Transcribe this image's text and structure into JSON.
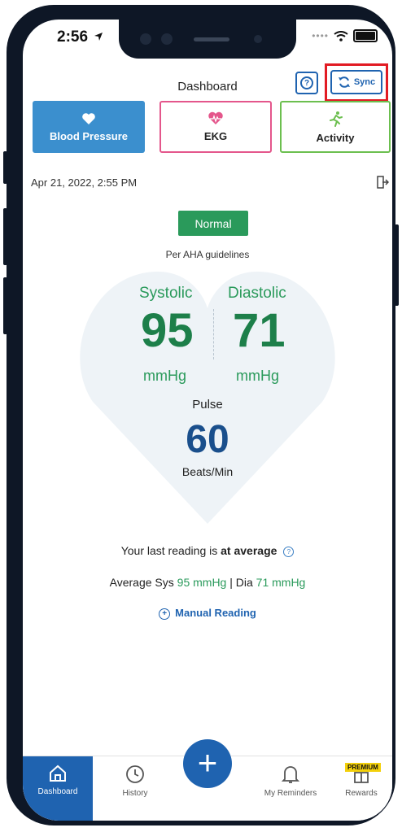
{
  "status_bar": {
    "time": "2:56"
  },
  "header": {
    "title": "Dashboard",
    "sync_label": "Sync"
  },
  "tabs": [
    {
      "label": "Blood Pressure",
      "icon": "heart-icon"
    },
    {
      "label": "EKG",
      "icon": "ekg-heart-icon"
    },
    {
      "label": "Activity",
      "icon": "runner-icon"
    }
  ],
  "reading": {
    "datetime": "Apr 21, 2022, 2:55 PM",
    "category": "Normal",
    "guideline": "Per AHA guidelines",
    "systolic_label": "Systolic",
    "systolic_value": "95",
    "diastolic_label": "Diastolic",
    "diastolic_value": "71",
    "pressure_unit": "mmHg",
    "pulse_label": "Pulse",
    "pulse_value": "60",
    "pulse_unit": "Beats/Min"
  },
  "summary": {
    "last_reading_prefix": "Your last reading is ",
    "last_reading_status": "at average",
    "avg_sys_prefix": "Average Sys ",
    "avg_sys_value": "95 mmHg",
    "avg_separator": " | Dia ",
    "avg_dia_value": "71 mmHg",
    "manual_reading": "Manual Reading"
  },
  "bottom_nav": {
    "items": [
      {
        "label": "Dashboard",
        "icon": "home-icon"
      },
      {
        "label": "History",
        "icon": "clock-icon"
      },
      {
        "label": "My Reminders",
        "icon": "bell-icon"
      },
      {
        "label": "Rewards",
        "icon": "gift-icon"
      }
    ],
    "add_label": "+",
    "premium_badge": "PREMIUM"
  },
  "colors": {
    "primary_blue": "#1f63b0",
    "tab_blue": "#3b8fce",
    "green": "#2a9a5b",
    "ekg_pink": "#e4568b",
    "activity_green": "#6cbf4f",
    "highlight_red": "#e21b23"
  }
}
